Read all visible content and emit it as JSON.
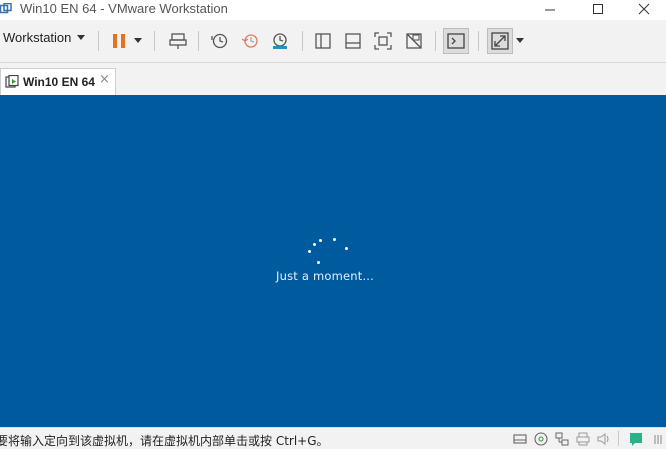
{
  "window": {
    "title": "Win10 EN 64 - VMware Workstation",
    "controls": [
      "minimize",
      "maximize",
      "close"
    ]
  },
  "toolbar": {
    "workstation_menu": "Workstation",
    "tools": [
      "pause-icon",
      "send-keys-icon",
      "snapshot-take-icon",
      "snapshot-revert-icon",
      "snapshot-manager-icon",
      "library-view-icon",
      "thumbnail-view-icon",
      "fullscreen-fit-icon",
      "unity-disabled-icon",
      "console-icon",
      "stretch-fullscreen-icon"
    ]
  },
  "tabs": [
    {
      "label": "Win10 EN 64",
      "close": "×"
    }
  ],
  "vm_screen": {
    "message": "Just a moment...",
    "background": "#005a9e"
  },
  "statusbar": {
    "hint": "要将输入定向到该虚拟机，请在虚拟机内部单击或按 Ctrl+G。",
    "icons": [
      "hard-disk-icon",
      "cd-dvd-icon",
      "network-icon",
      "printer-icon",
      "sound-icon",
      "message-icon"
    ]
  },
  "colors": {
    "accent_pause": "#e8711c",
    "vm_background": "#005a9e"
  }
}
